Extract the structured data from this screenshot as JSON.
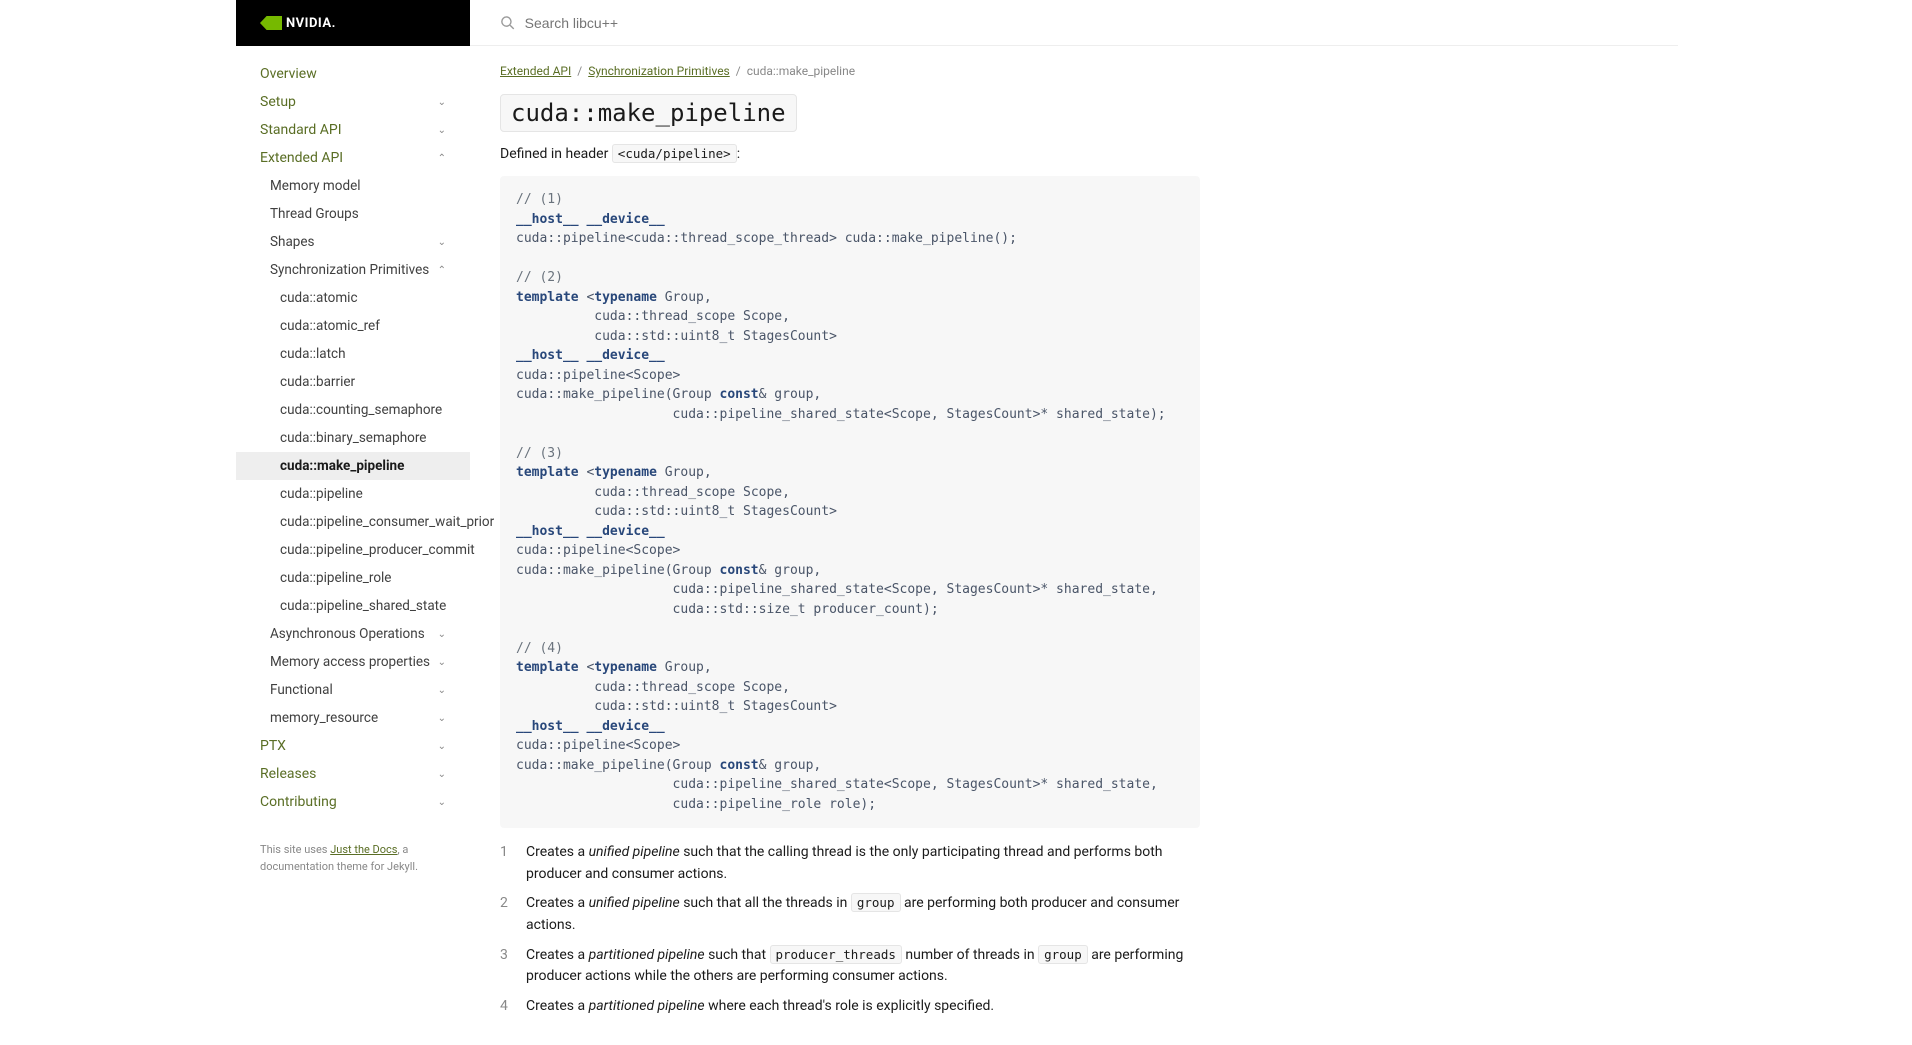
{
  "logo_text": "NVIDIA.",
  "search_placeholder": "Search libcu++",
  "nav": {
    "overview": "Overview",
    "setup": "Setup",
    "standard_api": "Standard API",
    "extended_api": "Extended API",
    "memory_model": "Memory model",
    "thread_groups": "Thread Groups",
    "shapes": "Shapes",
    "sync_prim": "Synchronization Primitives",
    "items": [
      "cuda::atomic",
      "cuda::atomic_ref",
      "cuda::latch",
      "cuda::barrier",
      "cuda::counting_semaphore",
      "cuda::binary_semaphore",
      "cuda::make_pipeline",
      "cuda::pipeline",
      "cuda::pipeline_consumer_wait_prior",
      "cuda::pipeline_producer_commit",
      "cuda::pipeline_role",
      "cuda::pipeline_shared_state"
    ],
    "async_ops": "Asynchronous Operations",
    "mem_access": "Memory access properties",
    "functional": "Functional",
    "mem_resource": "memory_resource",
    "ptx": "PTX",
    "releases": "Releases",
    "contributing": "Contributing"
  },
  "footer": {
    "pre": "This site uses ",
    "link": "Just the Docs",
    "post": ", a documentation theme for Jekyll."
  },
  "breadcrumb": {
    "a1": "Extended API",
    "a2": "Synchronization Primitives",
    "current": "cuda::make_pipeline"
  },
  "title": "cuda::make_pipeline",
  "defined_pre": "Defined in header ",
  "defined_header": "<cuda/pipeline>",
  "defined_post": ":",
  "code_lines": [
    {
      "t": "comment",
      "v": "// (1)"
    },
    {
      "t": "hostdev",
      "v": "__host__ __device__"
    },
    {
      "t": "sig1",
      "v": "cuda::pipeline<cuda::thread_scope_thread> cuda::make_pipeline();"
    },
    {
      "t": "blank",
      "v": ""
    },
    {
      "t": "comment",
      "v": "// (2)"
    },
    {
      "t": "tmpl_open",
      "v": "template <typename Group,"
    },
    {
      "t": "tmpl_line",
      "v": "          cuda::thread_scope Scope,"
    },
    {
      "t": "tmpl_line",
      "v": "          cuda::std::uint8_t StagesCount>"
    },
    {
      "t": "hostdev",
      "v": "__host__ __device__"
    },
    {
      "t": "plain",
      "v": "cuda::pipeline<Scope>"
    },
    {
      "t": "sig2a",
      "v": "cuda::make_pipeline(Group const& group,"
    },
    {
      "t": "sig2b",
      "v": "                    cuda::pipeline_shared_state<Scope, StagesCount>* shared_state);"
    },
    {
      "t": "blank",
      "v": ""
    },
    {
      "t": "comment",
      "v": "// (3)"
    },
    {
      "t": "tmpl_open",
      "v": "template <typename Group,"
    },
    {
      "t": "tmpl_line",
      "v": "          cuda::thread_scope Scope,"
    },
    {
      "t": "tmpl_line",
      "v": "          cuda::std::uint8_t StagesCount>"
    },
    {
      "t": "hostdev",
      "v": "__host__ __device__"
    },
    {
      "t": "plain",
      "v": "cuda::pipeline<Scope>"
    },
    {
      "t": "sig2a",
      "v": "cuda::make_pipeline(Group const& group,"
    },
    {
      "t": "sig3b",
      "v": "                    cuda::pipeline_shared_state<Scope, StagesCount>* shared_state,"
    },
    {
      "t": "sig3c",
      "v": "                    cuda::std::size_t producer_count);"
    },
    {
      "t": "blank",
      "v": ""
    },
    {
      "t": "comment",
      "v": "// (4)"
    },
    {
      "t": "tmpl_open",
      "v": "template <typename Group,"
    },
    {
      "t": "tmpl_line",
      "v": "          cuda::thread_scope Scope,"
    },
    {
      "t": "tmpl_line",
      "v": "          cuda::std::uint8_t StagesCount>"
    },
    {
      "t": "hostdev",
      "v": "__host__ __device__"
    },
    {
      "t": "plain",
      "v": "cuda::pipeline<Scope>"
    },
    {
      "t": "sig2a",
      "v": "cuda::make_pipeline(Group const& group,"
    },
    {
      "t": "sig3b",
      "v": "                    cuda::pipeline_shared_state<Scope, StagesCount>* shared_state,"
    },
    {
      "t": "sig4c",
      "v": "                    cuda::pipeline_role role);"
    }
  ],
  "overloads": {
    "1": {
      "pre": "Creates a ",
      "em": "unified pipeline",
      "post": " such that the calling thread is the only participating thread and performs both producer and consumer actions."
    },
    "2": {
      "pre": "Creates a ",
      "em": "unified pipeline",
      "post1": " such that all the threads in ",
      "code": "group",
      "post2": " are performing both producer and consumer actions."
    },
    "3": {
      "pre": "Creates a ",
      "em": "partitioned pipeline",
      "post1": " such that ",
      "code1": "producer_threads",
      "mid": " number of threads in ",
      "code2": "group",
      "post2": " are performing producer actions while the others are performing consumer actions."
    },
    "4": {
      "pre": "Creates a ",
      "em": "partitioned pipeline",
      "post": " where each thread's role is explicitly specified."
    }
  }
}
